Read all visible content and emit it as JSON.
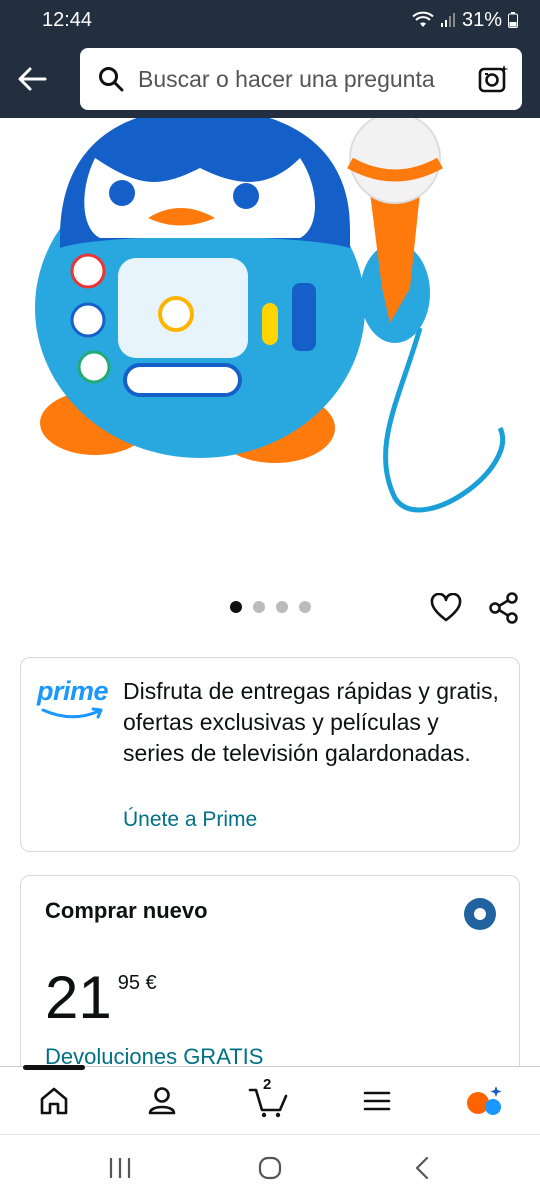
{
  "status_bar": {
    "time": "12:44",
    "battery": "31%"
  },
  "search": {
    "placeholder": "Buscar o hacer una pregunta"
  },
  "product_image": {
    "alt": "Juguete pingüino azul con micrófono"
  },
  "carousel": {
    "total_images": 4,
    "active_index": 0
  },
  "prime": {
    "logo": "prime",
    "message": "Disfruta de entregas rápidas y gratis, ofertas exclusivas y películas y series de televisión galardonadas.",
    "join_link": "Únete a Prime"
  },
  "buy_box": {
    "title": "Comprar nuevo",
    "price_whole": "21",
    "price_fraction": "95 €",
    "returns": "Devoluciones GRATIS"
  },
  "bottom_nav": {
    "items": [
      "home",
      "account",
      "cart",
      "menu",
      "rufus"
    ],
    "active": "home",
    "cart_count": "2"
  },
  "icons": {
    "back": "arrow-left-icon",
    "search": "search-icon",
    "camera": "camera-search-icon",
    "favorite": "heart-icon",
    "share": "share-icon"
  },
  "colors": {
    "header_bg": "#232f3e",
    "link": "#007185",
    "prime_blue": "#1a98ff",
    "radio_blue": "#2162a1",
    "rufus_orange": "#ff6200"
  }
}
